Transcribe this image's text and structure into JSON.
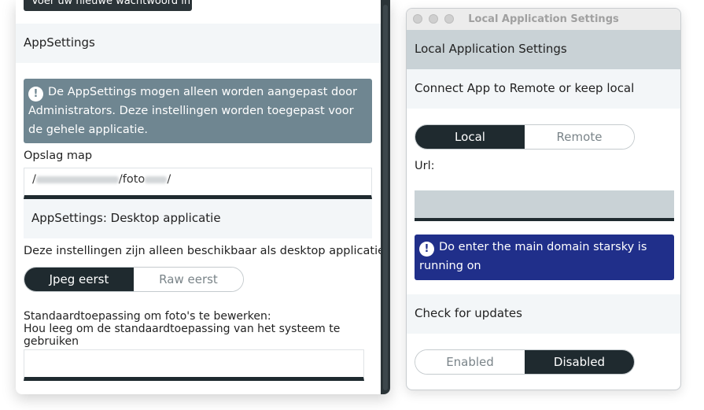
{
  "left": {
    "top_button_label": "Voer uw nieuwe wachtwoord in",
    "section_title": "AppSettings",
    "admin_notice": "De AppSettings mogen alleen worden aangepast door Administrators. Deze instellingen worden toegepast voor de gehele applicatie.",
    "storage_label": "Opslag map",
    "storage_value_prefix": "/",
    "storage_value_mid": "/foto",
    "storage_value_suffix": "/",
    "desktop_section_title": "AppSettings: Desktop applicatie",
    "desktop_note": "Deze instellingen zijn alleen beschikbaar als desktop applicatie",
    "toggle_jpeg": "Jpeg eerst",
    "toggle_raw": "Raw eerst",
    "editor_label_line1": "Standaardtoepassing om foto's te bewerken:",
    "editor_label_line2": "Hou leeg om de standaardtoepassing van het systeem te gebruiken",
    "editor_value": ""
  },
  "right": {
    "window_title": "Local Application Settings",
    "header": "Local Application Settings",
    "connect_section": "Connect App to Remote or keep local",
    "toggle_local": "Local",
    "toggle_remote": "Remote",
    "url_label": "Url:",
    "url_value": "",
    "domain_warning": "Do enter the main domain starsky is running on",
    "updates_section": "Check for updates",
    "toggle_enabled": "Enabled",
    "toggle_disabled": "Disabled"
  },
  "colors": {
    "dark": "#1f2a2f",
    "notice_bg": "#6f8691",
    "warning_bg": "#202f8a",
    "section_bg": "#f3f6f8",
    "header_bg": "#c9d2d6"
  }
}
